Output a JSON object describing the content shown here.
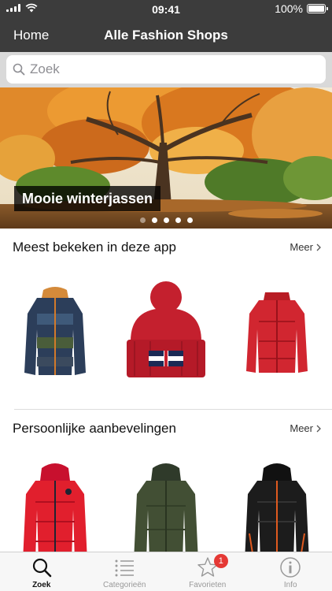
{
  "status_bar": {
    "time": "09:41",
    "battery": "100%"
  },
  "nav": {
    "back_label": "Home",
    "title": "Alle Fashion Shops"
  },
  "search": {
    "placeholder": "Zoek",
    "value": ""
  },
  "banner": {
    "caption": "Mooie winterjassen",
    "page_count": 5,
    "active_page": 1
  },
  "sections": [
    {
      "title": "Meest bekeken in deze app",
      "more_label": "Meer",
      "products": [
        {
          "name": "product-kids-puffer-jacket",
          "icon": "jacket-blue-camo"
        },
        {
          "name": "product-beanie",
          "icon": "beanie-red"
        },
        {
          "name": "product-red-puffer-jacket",
          "icon": "jacket-red"
        }
      ]
    },
    {
      "title": "Persoonlijke aanbevelingen",
      "more_label": "Meer",
      "products": [
        {
          "name": "product-red-winter-jacket",
          "icon": "jacket-red-hood"
        },
        {
          "name": "product-green-winter-jacket",
          "icon": "jacket-green-hood"
        },
        {
          "name": "product-black-winter-jacket",
          "icon": "jacket-black-hood"
        }
      ]
    }
  ],
  "tab_bar": {
    "tabs": [
      {
        "label": "Zoek",
        "icon": "search-icon",
        "active": true
      },
      {
        "label": "Categorieën",
        "icon": "list-icon",
        "active": false
      },
      {
        "label": "Favorieten",
        "icon": "star-icon",
        "active": false,
        "badge": "1"
      },
      {
        "label": "Info",
        "icon": "info-icon",
        "active": false
      }
    ]
  },
  "colors": {
    "bar_dark": "#3c3c3c",
    "accent_red": "#e53935",
    "search_bg": "#d9d9d9"
  }
}
